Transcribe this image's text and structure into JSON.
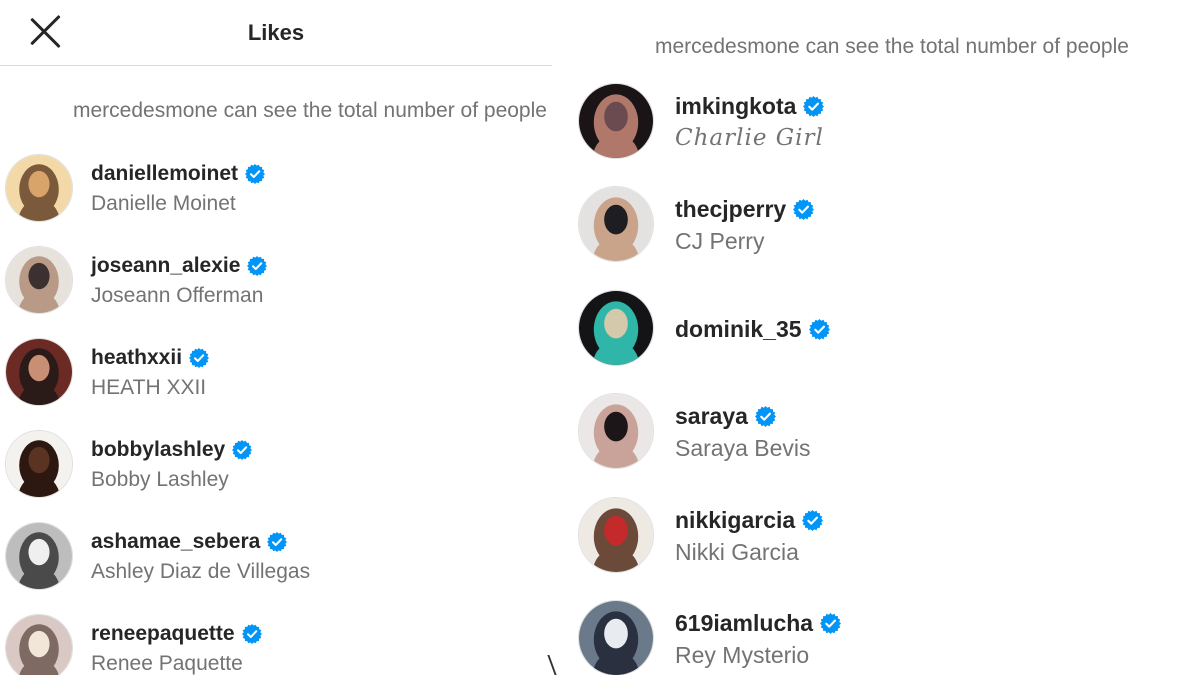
{
  "left_panel": {
    "header": {
      "title": "Likes"
    },
    "notice": "mercedesmone can see the total number of people",
    "users": [
      {
        "username": "daniellemoinet",
        "full_name": "Danielle Moinet",
        "verified": true,
        "avatar_colors": [
          "#f3d9a8",
          "#d9a46a",
          "#7a5a3a"
        ]
      },
      {
        "username": "joseann_alexie",
        "full_name": "Joseann Offerman",
        "verified": true,
        "avatar_colors": [
          "#e8e2dc",
          "#3c3030",
          "#b89a86"
        ]
      },
      {
        "username": "heathxxii",
        "full_name": "HEATH XXII",
        "verified": true,
        "avatar_colors": [
          "#6b2a24",
          "#c88f74",
          "#2b1b18"
        ]
      },
      {
        "username": "bobbylashley",
        "full_name": "Bobby Lashley",
        "verified": true,
        "avatar_colors": [
          "#f4f2ef",
          "#5a3322",
          "#2c1810"
        ]
      },
      {
        "username": "ashamae_sebera",
        "full_name": "Ashley Diaz de Villegas",
        "verified": true,
        "avatar_colors": [
          "#bdbdbd",
          "#efefef",
          "#4a4a4a"
        ]
      },
      {
        "username": "reneepaquette",
        "full_name": "Renee Paquette",
        "verified": true,
        "avatar_colors": [
          "#d9c8c3",
          "#f2e6d8",
          "#7e6a63"
        ]
      }
    ]
  },
  "right_panel": {
    "notice": "mercedesmone can see the total number of people",
    "users": [
      {
        "username": "imkingkota",
        "full_name": "Charlie Girl",
        "verified": true,
        "avatar_colors": [
          "#1a1416",
          "#6b4a50",
          "#b0786a"
        ]
      },
      {
        "username": "thecjperry",
        "full_name": "CJ Perry",
        "verified": true,
        "avatar_colors": [
          "#e4e2e0",
          "#1e1e22",
          "#c9a38a"
        ]
      },
      {
        "username": "dominik_35",
        "full_name": "",
        "verified": true,
        "avatar_colors": [
          "#141416",
          "#d4c9a8",
          "#2fb6a8"
        ]
      },
      {
        "username": "saraya",
        "full_name": "Saraya Bevis",
        "verified": true,
        "avatar_colors": [
          "#ebe7e6",
          "#1c1618",
          "#c9a39a"
        ]
      },
      {
        "username": "nikkigarcia",
        "full_name": "Nikki Garcia",
        "verified": true,
        "avatar_colors": [
          "#efe9e4",
          "#c42a2a",
          "#6b4a3a"
        ]
      },
      {
        "username": "619iamlucha",
        "full_name": "Rey Mysterio",
        "verified": true,
        "avatar_colors": [
          "#6b7a8a",
          "#e8ecf0",
          "#2a3040"
        ]
      }
    ]
  },
  "colors": {
    "verified_blue": "#0095f6",
    "username_text": "#262626",
    "secondary_text": "#737373",
    "border": "#dbdbdb"
  },
  "icons": {
    "close": "close-icon",
    "verified": "verified-badge-icon"
  }
}
